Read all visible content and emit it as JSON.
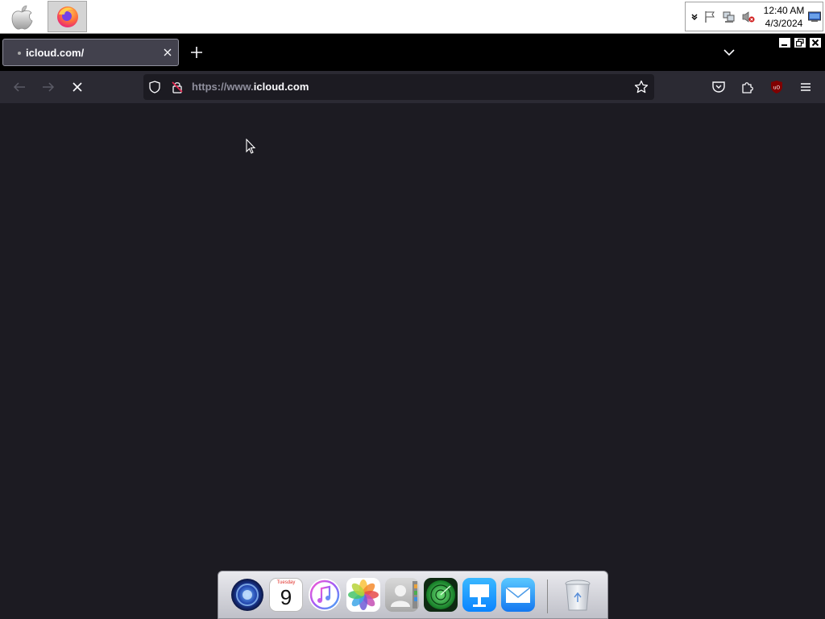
{
  "taskbar": {
    "apps": [
      {
        "name": "apple-menu"
      },
      {
        "name": "firefox"
      }
    ],
    "tray": {
      "time": "12:40 AM",
      "date": "4/3/2024",
      "icons": [
        "chevron-down-icon",
        "flag-icon",
        "network-icon",
        "volume-muted-icon",
        "display-icon"
      ]
    }
  },
  "browser": {
    "tab": {
      "title": "icloud.com/"
    },
    "url": {
      "prefix": "https://www.",
      "host": "icloud.com"
    }
  },
  "dock": {
    "items": [
      "Siri",
      "Calendar",
      "iTunes",
      "Photos",
      "Contacts",
      "Find My",
      "Keynote",
      "Mail",
      "Trash"
    ],
    "calendar": {
      "weekday": "Tuesday",
      "day": "9"
    }
  },
  "colors": {
    "content_bg": "#1c1b22",
    "toolbar_bg": "#2b2a33",
    "tab_bg": "#42414d",
    "firefox_orange": "#ff7139",
    "ublock_red": "#800000"
  }
}
